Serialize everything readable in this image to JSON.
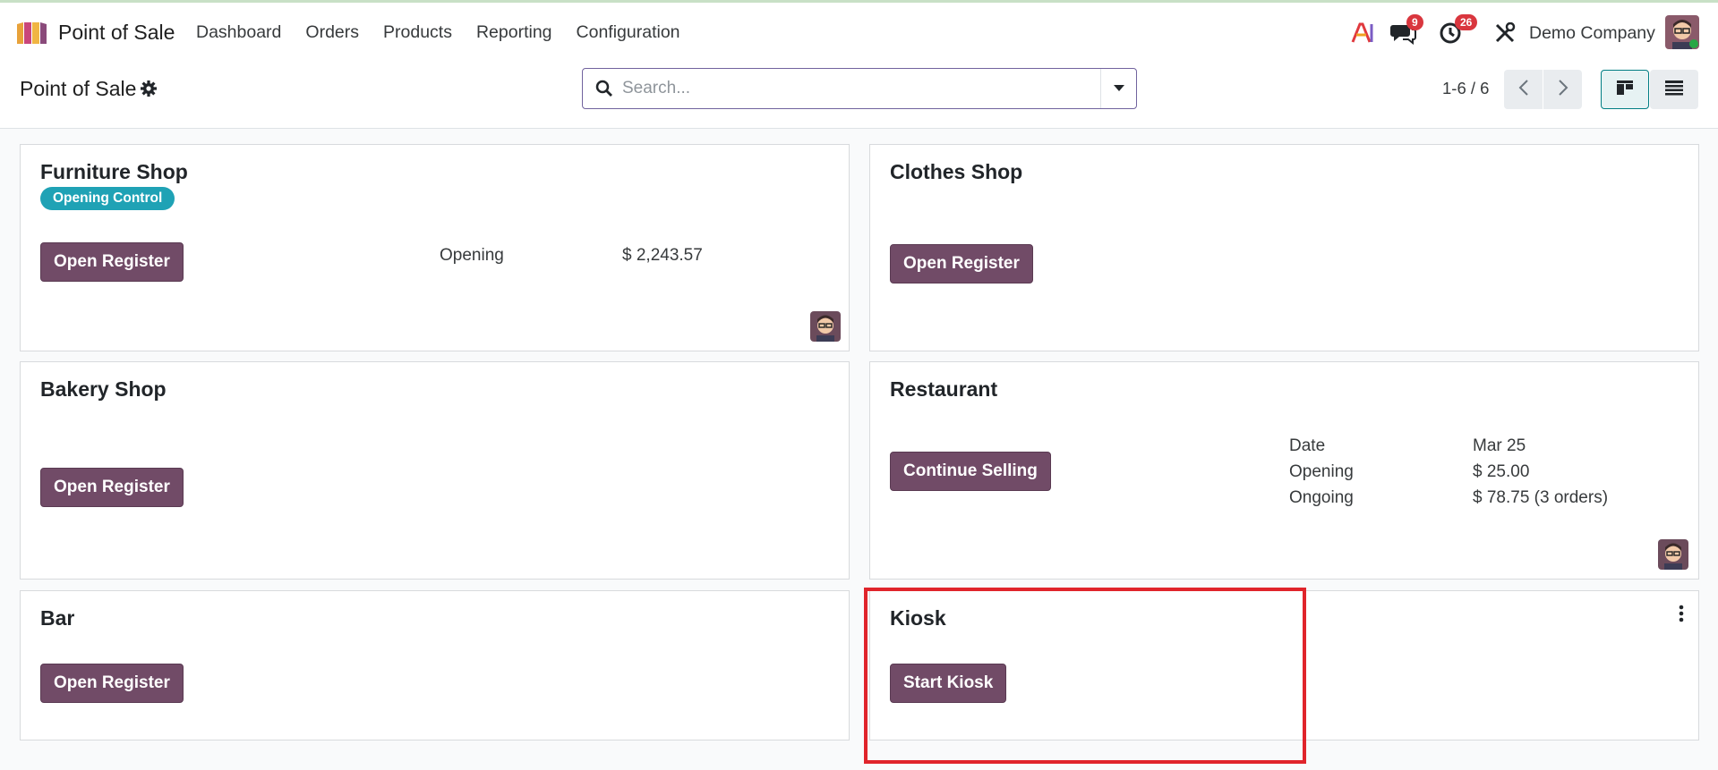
{
  "app": {
    "name": "Point of Sale",
    "menu": [
      "Dashboard",
      "Orders",
      "Products",
      "Reporting",
      "Configuration"
    ],
    "chat_badge": "9",
    "activity_badge": "26",
    "company": "Demo Company"
  },
  "control": {
    "title": "Point of Sale",
    "search_placeholder": "Search...",
    "pager": "1-6 / 6"
  },
  "cards": {
    "furniture": {
      "title": "Furniture Shop",
      "tag": "Opening Control",
      "button": "Open Register",
      "info_label": "Opening",
      "info_value": "$ 2,243.57"
    },
    "clothes": {
      "title": "Clothes Shop",
      "button": "Open Register"
    },
    "bakery": {
      "title": "Bakery Shop",
      "button": "Open Register"
    },
    "restaurant": {
      "title": "Restaurant",
      "button": "Continue Selling",
      "rows": [
        {
          "label": "Date",
          "value": "Mar 25"
        },
        {
          "label": "Opening",
          "value": "$ 25.00"
        },
        {
          "label": "Ongoing",
          "value": "$ 78.75 (3 orders)"
        }
      ]
    },
    "bar": {
      "title": "Bar",
      "button": "Open Register"
    },
    "kiosk": {
      "title": "Kiosk",
      "button": "Start Kiosk"
    }
  },
  "colors": {
    "primary": "#714b67",
    "tag": "#1fa2b5",
    "badge": "#d9363e",
    "highlight": "#e0242b"
  },
  "icons": [
    "pos-logo-icon",
    "ai-icon",
    "chat-icon",
    "activity-clock-icon",
    "tools-icon",
    "gear-icon",
    "search-icon",
    "caret-down-icon",
    "chevron-left-icon",
    "chevron-right-icon",
    "kanban-view-icon",
    "list-view-icon",
    "kebab-menu-icon"
  ]
}
